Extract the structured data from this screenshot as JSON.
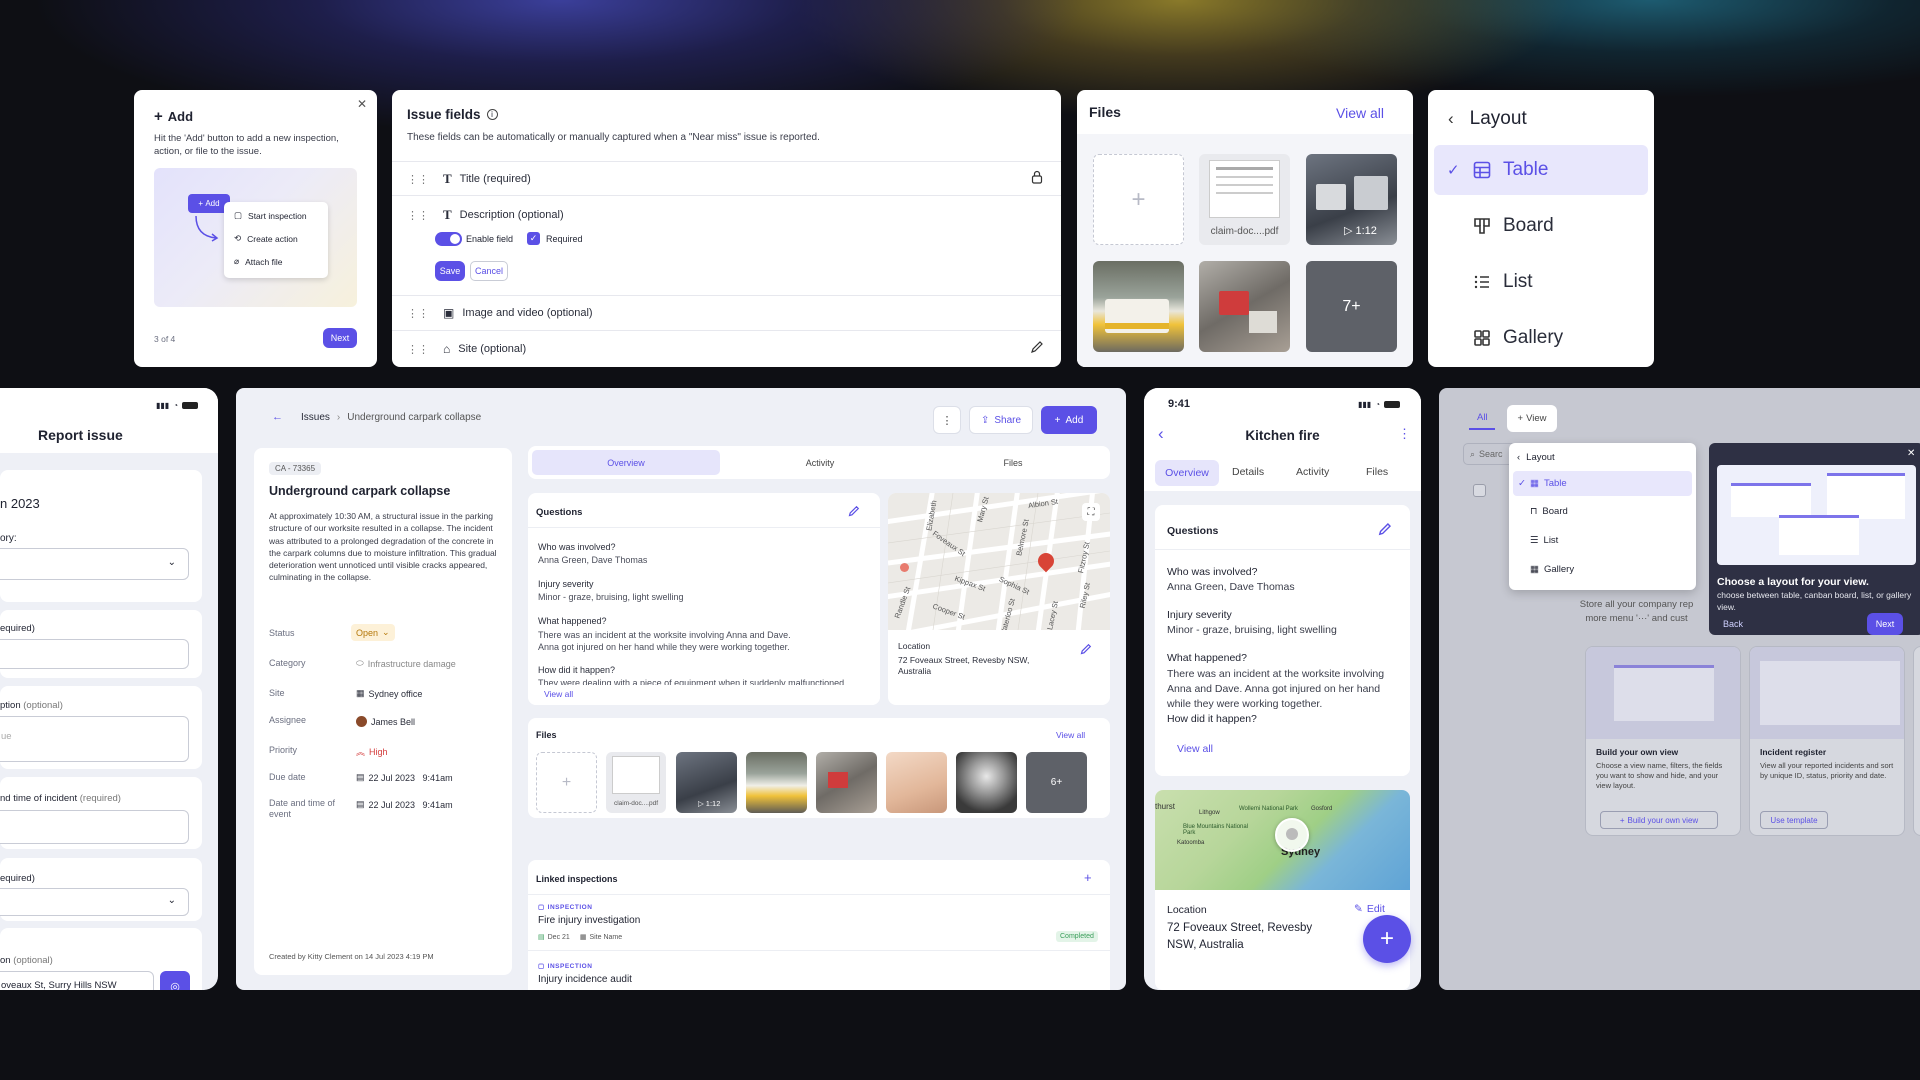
{
  "colors": {
    "accent": "#5b50e6",
    "danger": "#d33b3b",
    "success": "#3a9e5a"
  },
  "add_tip": {
    "title": "Add",
    "desc": "Hit the 'Add' button to add a new inspection, action, or file to the issue.",
    "add_btn": "Add",
    "menu": [
      "Start inspection",
      "Create action",
      "Attach file"
    ],
    "step": "3 of 4",
    "next": "Next"
  },
  "issue_fields": {
    "title": "Issue fields",
    "desc": "These fields can be automatically or manually captured when a \"Near miss\" issue is reported.",
    "fields": [
      "Title (required)",
      "Description (optional)",
      "Image and video (optional)",
      "Site (optional)"
    ],
    "enable": "Enable field",
    "required": "Required",
    "save": "Save",
    "cancel": "Cancel"
  },
  "files_card": {
    "title": "Files",
    "view_all": "View all",
    "pdf_name": "claim-doc....pdf",
    "video_duration": "1:12",
    "more": "7+"
  },
  "layout_menu": {
    "title": "Layout",
    "items": [
      "Table",
      "Board",
      "List",
      "Gallery"
    ],
    "selected": "Table"
  },
  "report": {
    "title": "Report issue",
    "date_partial": "n 2023",
    "fields": [
      "ory:",
      "equired)",
      "ption",
      "(optional)",
      "ue",
      "nd time of incident",
      "(required)",
      "equired)",
      "on",
      "(optional)",
      "oveaux St, Surry Hills NSW"
    ]
  },
  "issue_page": {
    "breadcrumb": [
      "Issues",
      "Underground carpark collapse"
    ],
    "share": "Share",
    "add": "Add",
    "id_badge": "CA - 73365",
    "title": "Underground carpark collapse",
    "description": "At approximately 10:30 AM, a structural issue in the parking structure of our worksite resulted in a collapse. The incident was attributed to a prolonged degradation of the concrete in the carpark columns due to moisture infiltration. This gradual deterioration went unnoticed until visible cracks appeared, culminating in the collapse.",
    "props": [
      {
        "label": "Status",
        "value": "Open"
      },
      {
        "label": "Category",
        "value": "Infrastructure damage"
      },
      {
        "label": "Site",
        "value": "Sydney office"
      },
      {
        "label": "Assignee",
        "value": "James Bell"
      },
      {
        "label": "Priority",
        "value": "High"
      },
      {
        "label": "Due date",
        "value": "22 Jul 2023   9:41am"
      },
      {
        "label": "Date and time of event",
        "value": "22 Jul 2023   9:41am"
      }
    ],
    "created": "Created by Kitty Clement on 14 Jul 2023 4:19 PM",
    "tabs": [
      "Overview",
      "Activity",
      "Files"
    ],
    "questions_title": "Questions",
    "questions": [
      {
        "q": "Who was involved?",
        "a": "Anna Green, Dave Thomas"
      },
      {
        "q": "Injury severity",
        "a": "Minor - graze, bruising, light swelling"
      },
      {
        "q": "What happened?",
        "a": "There was an incident at the worksite involving Anna and Dave. Anna got injured on her hand while they were working together."
      },
      {
        "q": "How did it happen?",
        "a": "They were dealing with a piece of equipment when it suddenly malfunctioned."
      }
    ],
    "view_all": "View all",
    "location_label": "Location",
    "location": "72 Foveaux Street, Revesby NSW, Australia",
    "map_streets": [
      "Elizabeth",
      "Albion St",
      "Foveaux St",
      "Mary St",
      "Belmore St",
      "Fitzroy St",
      "Kippax St",
      "Sophia St",
      "Riley St",
      "Randle St",
      "Cooper St",
      "Waterloo St",
      "Lacey St"
    ],
    "files_title": "Files",
    "files_view_all": "View all",
    "pdf_name": "claim-doc....pdf",
    "video_duration": "1:12",
    "more": "6+",
    "linked_title": "Linked inspections",
    "inspections": [
      {
        "tag": "INSPECTION",
        "name": "Fire injury investigation",
        "date": "Dec 21",
        "site": "Site Name",
        "status": "Completed"
      },
      {
        "tag": "INSPECTION",
        "name": "Injury incidence audit"
      }
    ]
  },
  "mobile": {
    "time": "9:41",
    "title": "Kitchen fire",
    "tabs": [
      "Overview",
      "Details",
      "Activity",
      "Files"
    ],
    "questions_title": "Questions",
    "questions": [
      {
        "q": "Who was involved?",
        "a": "Anna Green, Dave Thomas"
      },
      {
        "q": "Injury severity",
        "a": "Minor - graze, bruising, light swelling"
      },
      {
        "q": "What happened?",
        "a": "There was an incident at the worksite involving Anna and Dave. Anna got injured on her hand while they were working together."
      },
      {
        "q": "How did it happen?",
        "a": ""
      }
    ],
    "view_all": "View all",
    "map_labels": [
      "thurst",
      "Lithgow",
      "Wollemi National Park",
      "Gosford",
      "Blue Mountains National Park",
      "Katoomba",
      "Sydney"
    ],
    "location_label": "Location",
    "edit": "Edit",
    "location": "72 Foveaux Street, Revesby NSW, Australia"
  },
  "views": {
    "tab_all": "All",
    "view_btn": "View",
    "search": "Searc",
    "menu_title": "Layout",
    "menu": [
      "Table",
      "Board",
      "List",
      "Gallery"
    ],
    "tip_title": "Choose a layout for your view.",
    "tip_desc": "choose between table, canban board, list, or gallery view.",
    "back": "Back",
    "next": "Next",
    "store_text": "Store all your company rep more menu '···' and cust",
    "templates": [
      {
        "title": "Build your own view",
        "desc": "Choose a view name, filters, the fields you want to show and hide, and your view layout.",
        "btn": "Build your own view"
      },
      {
        "title": "Incident register",
        "desc": "View all your reported incidents and sort by unique ID, status, priority and date.",
        "btn": "Use template"
      }
    ]
  }
}
